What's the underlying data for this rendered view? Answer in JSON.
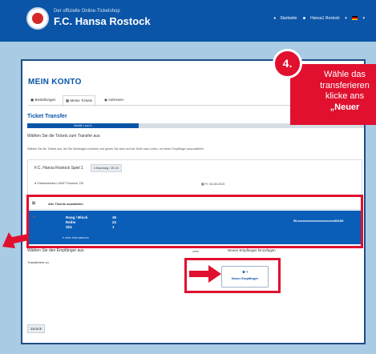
{
  "header": {
    "subtitle": "Der offizielle Online-Ticketshop",
    "title": "F.C. Hansa Rostock",
    "nav": [
      "Startseite",
      "Hansa1 Rostock"
    ]
  },
  "account": {
    "heading": "MEIN KONTO",
    "tabs": [
      "Bestellungen",
      "Meine Tickets",
      "Adressen"
    ]
  },
  "transfer": {
    "heading": "Ticket Transfer",
    "progress_label": "Schritt 1 von 3",
    "progress_fraction": 0.33,
    "step_title": "Wählen Sie die Tickets zum Transfer aus",
    "step_hint": "Wählen Sie die Tickets aus, die Sie übertragen möchten und gehen Sie dann auf der Seite nach unten, um einen Empfänger auszuwählen.",
    "event": {
      "title": "F.C. Hansa Rostock Spiel 1",
      "badge": "1 Buchung / 25 2h",
      "venue": "Ostseestadion 18057 Rostock, DE",
      "date": "Fr. 04.08.2023"
    },
    "table": {
      "select_all": "Alle Tickets auswählen",
      "row": {
        "labels": [
          "Rang / Block",
          "Reihe",
          "Sitz"
        ],
        "values": [
          "36",
          "22",
          "1"
        ],
        "more": "mehr Informationen",
        "code": "55-xxxxxxxxxxxxxxxxxxxxxxx89AD8"
      }
    },
    "recipient_label": "Wählen Sie den Empfänger aus",
    "or": "oder",
    "new_recipient_heading": "Neuen Empfänger hinzufügen",
    "transfer_to": "Transferiere zu",
    "new_recipient_button": "Neuer Empfänger",
    "back_button": "Zurück"
  },
  "overlay": {
    "step_number": "4.",
    "text_lines": [
      "Wähle das",
      "transferieren",
      "klicke ans",
      "„Neuer"
    ],
    "accent_color": "#e0102e"
  },
  "colors": {
    "brand_blue": "#0a55a8",
    "row_blue": "#0a5eb8",
    "background": "#a9cbe3"
  }
}
